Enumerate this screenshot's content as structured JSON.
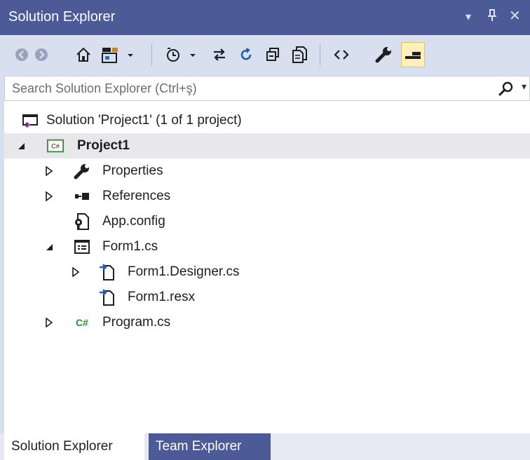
{
  "window": {
    "title": "Solution Explorer",
    "controls": {
      "dropdown": "▾",
      "pin": "ᵖ",
      "close": "✕"
    }
  },
  "toolbar": {
    "buttons": [
      {
        "name": "back",
        "icon": "back-circle-icon"
      },
      {
        "name": "forward",
        "icon": "forward-circle-icon"
      },
      {
        "name": "home",
        "icon": "home-icon"
      },
      {
        "name": "switch-views",
        "icon": "switch-views-icon",
        "dropdown": true
      },
      {
        "name": "pending-changes-filter",
        "icon": "clock-filter-icon",
        "dropdown": true
      },
      {
        "name": "sync-with-active-document",
        "icon": "sync-arrows-icon"
      },
      {
        "name": "refresh",
        "icon": "refresh-icon"
      },
      {
        "name": "collapse-all",
        "icon": "collapse-all-icon"
      },
      {
        "name": "show-all-files",
        "icon": "show-all-files-icon"
      },
      {
        "name": "view-code",
        "icon": "code-brackets-icon"
      },
      {
        "name": "properties",
        "icon": "wrench-icon"
      },
      {
        "name": "preview-selected-items",
        "icon": "preview-icon",
        "active": true
      }
    ]
  },
  "search": {
    "placeholder": "Search Solution Explorer (Ctrl+ş)",
    "value": ""
  },
  "tree": {
    "solution": "Solution 'Project1' (1 of 1 project)",
    "project": "Project1",
    "properties": "Properties",
    "references": "References",
    "app_config": "App.config",
    "form1": "Form1.cs",
    "form1_designer": "Form1.Designer.cs",
    "form1_resx": "Form1.resx",
    "program": "Program.cs",
    "csharp_badge": "C#"
  },
  "tabs": [
    {
      "label": "Solution Explorer",
      "active": true
    },
    {
      "label": "Team Explorer",
      "active": false
    }
  ],
  "colors": {
    "titlebar": "#4c5b97",
    "toolbar": "#d8dfee",
    "selection": "#e8e8ec",
    "csharp_green": "#388a34",
    "active_toggle": "#ffefbb"
  }
}
